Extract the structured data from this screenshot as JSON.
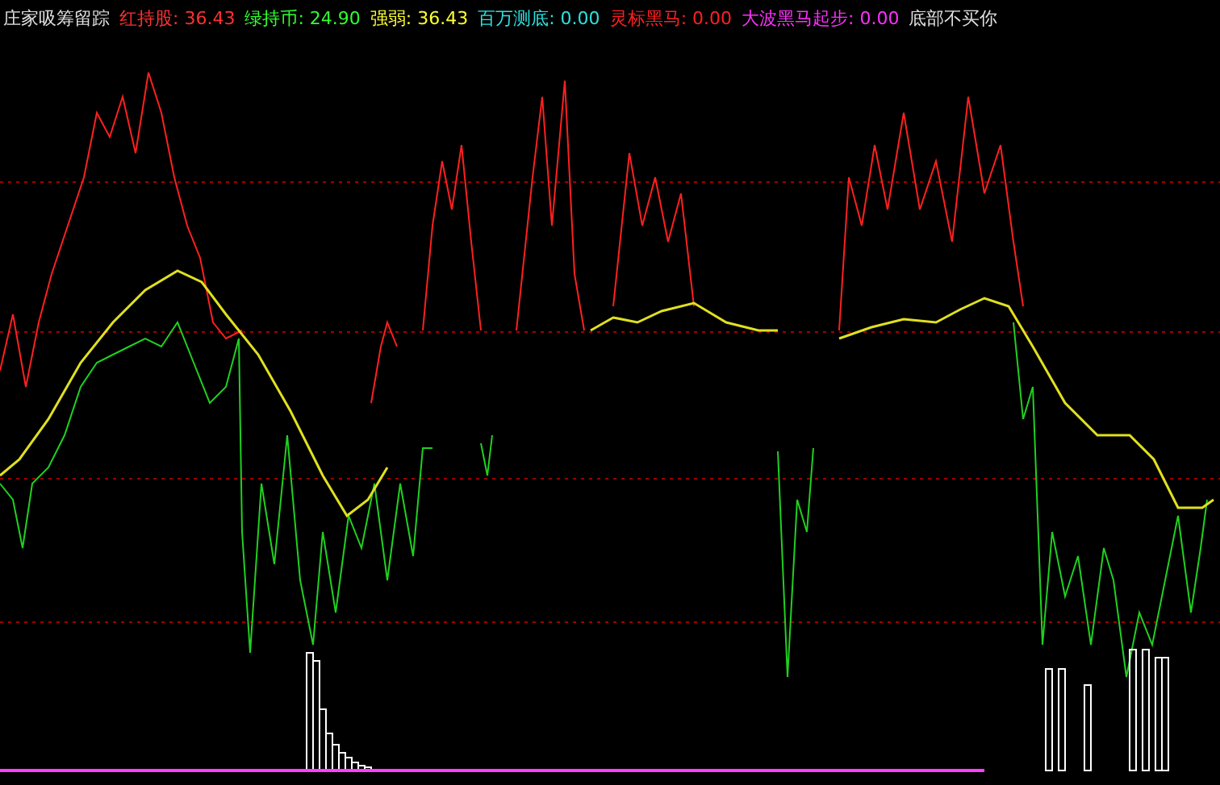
{
  "indicator": {
    "title": "庄家吸筹留踪",
    "legend": [
      {
        "text": "红持股: 36.43",
        "color": "#ff3030"
      },
      {
        "text": "绿持币: 24.90",
        "color": "#30ff30"
      },
      {
        "text": "强弱: 36.43",
        "color": "#ffff30"
      },
      {
        "text": "百万测底: 0.00",
        "color": "#30e0e0"
      },
      {
        "text": "灵标黑马: 0.00",
        "color": "#ff2020"
      },
      {
        "text": "大波黑马起步: 0.00",
        "color": "#ff30ff"
      },
      {
        "text": "底部不买你",
        "color": "#e0e0e0"
      }
    ]
  }
}
